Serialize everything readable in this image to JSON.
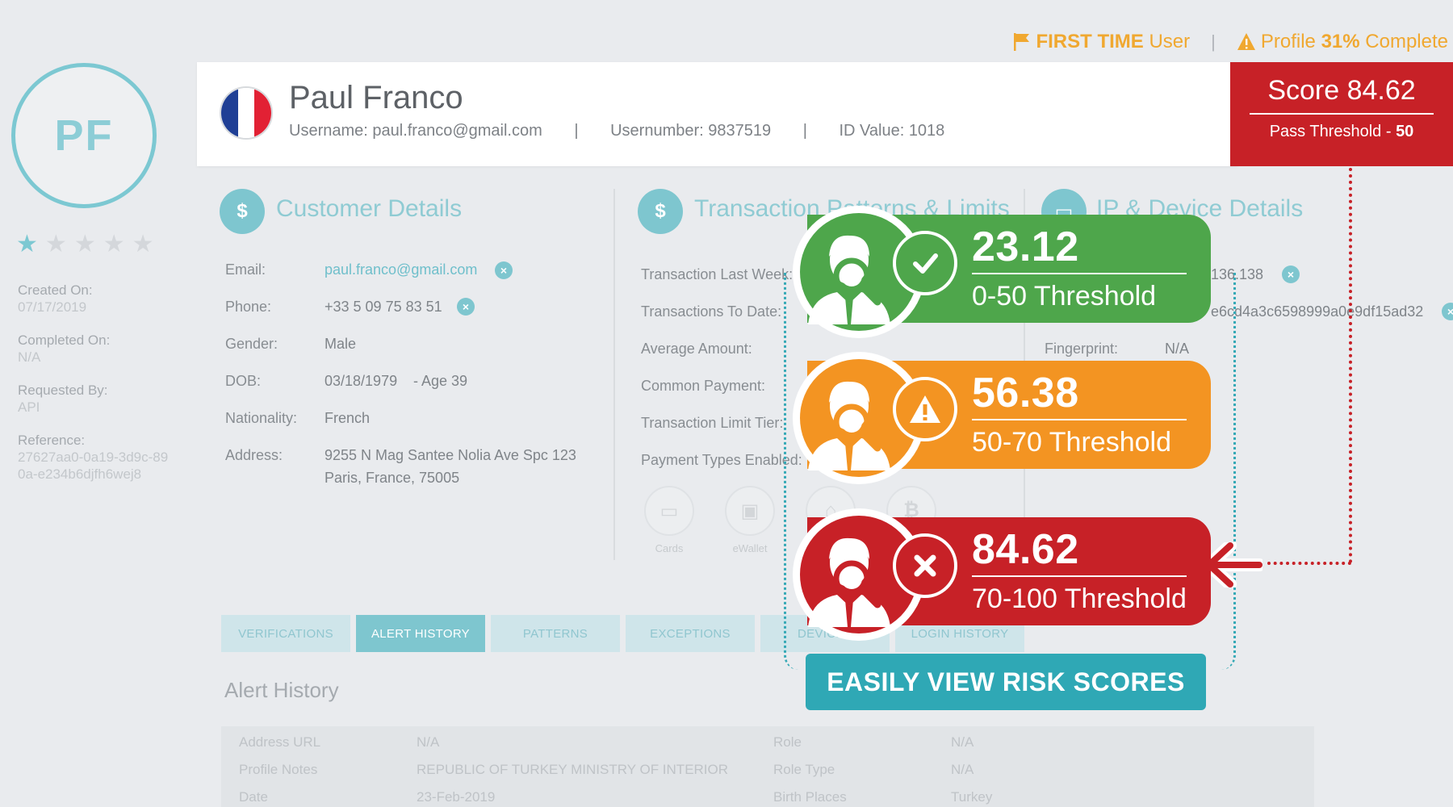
{
  "topbar": {
    "first_time_strong": "FIRST TIME",
    "first_time_rest": " User",
    "separator": "|",
    "profile_prefix": "Profile ",
    "profile_percent": "31%",
    "profile_suffix": " Complete"
  },
  "profile": {
    "initials": "PF",
    "rating": 1,
    "rating_max": 5,
    "created_label": "Created On:",
    "created_value": "07/17/2019",
    "completed_label": "Completed On:",
    "completed_value": "N/A",
    "requested_label": "Requested By:",
    "requested_value": "API",
    "reference_label": "Reference:",
    "reference_value": "27627aa0-0a19-3d9c-890a-e234b6djfh6wej8"
  },
  "header": {
    "name": "Paul Franco",
    "username_label": "Username:",
    "username_value": "paul.franco@gmail.com",
    "usernumber_label": "Usernumber:",
    "usernumber_value": "9837519",
    "id_label": "ID Value:",
    "id_value": "1018",
    "divider": "|",
    "flag_colors": [
      "#1f3f95",
      "#ffffff",
      "#e22134"
    ]
  },
  "score": {
    "title": "Score 84.62",
    "threshold_label": "Pass Threshold - ",
    "threshold_value": "50"
  },
  "customer": {
    "title": "Customer Details",
    "email_label": "Email:",
    "email_value": "paul.franco@gmail.com",
    "phone_label": "Phone:",
    "phone_value": "+33 5 09 75 83 51",
    "gender_label": "Gender:",
    "gender_value": "Male",
    "dob_label": "DOB:",
    "dob_value": "03/18/1979",
    "dob_age": "- Age 39",
    "nationality_label": "Nationality:",
    "nationality_value": "French",
    "address_label": "Address:",
    "address_line1": "9255 N Mag Santee Nolia Ave Spc 123",
    "address_line2": "Paris, France, 75005"
  },
  "transactions": {
    "title": "Transaction Patterns & Limits",
    "rows": [
      "Transaction Last Week:",
      "Transactions To Date:",
      "Average Amount:",
      "Common Payment:",
      "Transaction Limit Tier:",
      "Payment Types Enabled:"
    ],
    "payment_types": [
      "Cards",
      "eWallet",
      "",
      ""
    ]
  },
  "ip": {
    "title": "IP & Device Details",
    "ip_partial": "136.138",
    "hash_partial": "e6cd4a3c6598999a0e9df15ad32",
    "fingerprint_label": "Fingerprint:",
    "fingerprint_value": "N/A"
  },
  "tabs": [
    "VERIFICATIONS",
    "ALERT HISTORY",
    "PATTERNS",
    "EXCEPTIONS",
    "DEVICES",
    "LOGIN HISTORY"
  ],
  "active_tab": 1,
  "alert_history": {
    "title": "Alert History",
    "rows": [
      {
        "k1": "Address URL",
        "v1": "N/A",
        "k2": "Role",
        "v2": "N/A"
      },
      {
        "k1": "Profile Notes",
        "v1": "REPUBLIC OF TURKEY MINISTRY OF INTERIOR",
        "k2": "Role Type",
        "v2": "N/A"
      },
      {
        "k1": "Date",
        "v1": "23-Feb-2019",
        "k2": "Birth Places",
        "v2": "Turkey"
      }
    ]
  },
  "risk_cards": [
    {
      "score": "23.12",
      "threshold": "0-50 Threshold",
      "status": "pass",
      "color": "#4ea64b",
      "icon": "check-icon"
    },
    {
      "score": "56.38",
      "threshold": "50-70 Threshold",
      "status": "warning",
      "color": "#f39422",
      "icon": "warning-icon"
    },
    {
      "score": "84.62",
      "threshold": "70-100 Threshold",
      "status": "fail",
      "color": "#c72127",
      "icon": "x-icon"
    }
  ],
  "cta": {
    "label": "EASILY VIEW RISK SCORES"
  }
}
